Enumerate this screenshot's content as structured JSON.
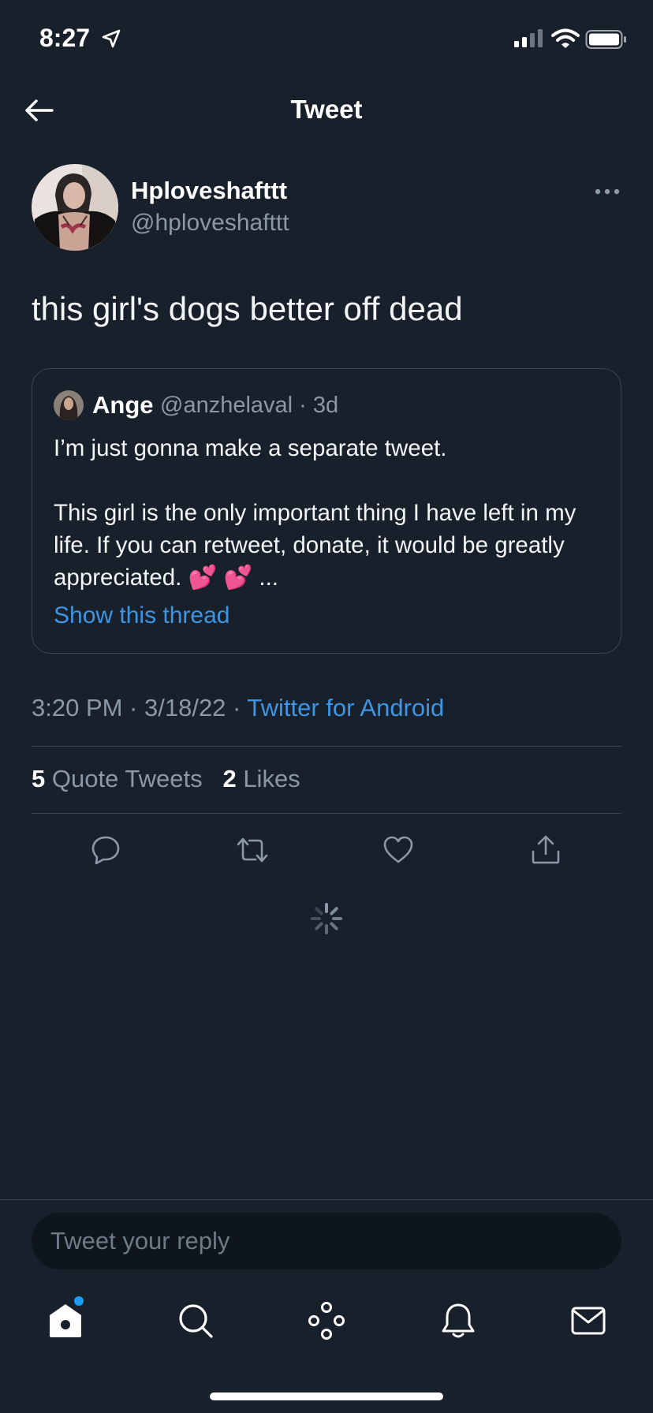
{
  "status_bar": {
    "time": "8:27"
  },
  "header": {
    "title": "Tweet"
  },
  "tweet": {
    "display_name": "Hploveshafttt",
    "handle": "@hploveshafttt",
    "text": "this girl's dogs better off dead",
    "timestamp": "3:20 PM · 3/18/22 · ",
    "source": "Twitter for Android",
    "stats": {
      "quote_tweets_count": "5",
      "quote_tweets_label": "Quote Tweets",
      "likes_count": "2",
      "likes_label": "Likes"
    }
  },
  "quoted_tweet": {
    "name": "Ange",
    "meta": "@anzhelaval · 3d",
    "body": "I’m just gonna make a separate tweet.\n\nThis girl is the only important thing I have left in my life. If you can retweet, donate, it would be greatly appreciated. 💕 💕 ...",
    "show_thread": "Show this thread"
  },
  "reply": {
    "placeholder": "Tweet your reply"
  },
  "icons": {
    "back": "arrow-left-icon",
    "more": "more-horizontal-icon",
    "reply": "reply-icon",
    "retweet": "retweet-icon",
    "like": "heart-icon",
    "share": "share-icon",
    "nav": [
      "home-icon",
      "search-icon",
      "spaces-icon",
      "notifications-icon",
      "messages-icon"
    ]
  },
  "colors": {
    "background": "#18202c",
    "accent": "#3d95e4",
    "muted": "#8b98a5",
    "divider": "#38444d"
  }
}
